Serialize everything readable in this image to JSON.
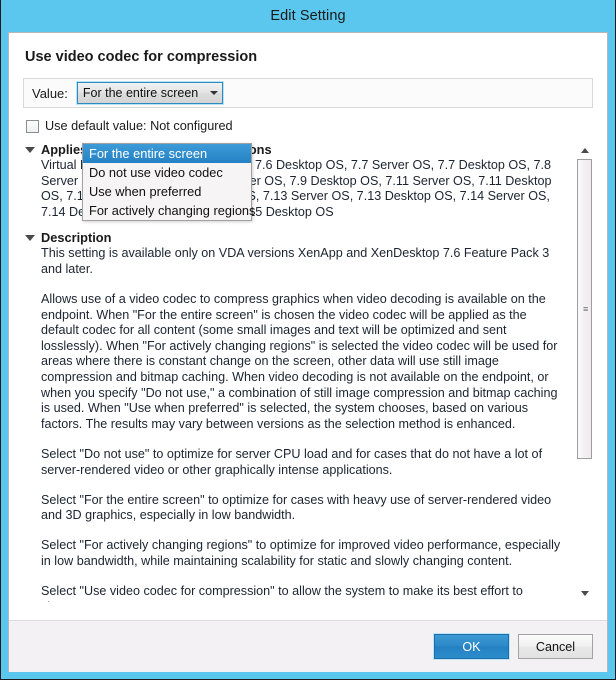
{
  "window": {
    "title": "Edit Setting",
    "accent_color": "#5bc7ee"
  },
  "setting": {
    "title": "Use video codec for compression",
    "value_label": "Value:",
    "current_value": "For the entire screen",
    "dropdown_open": true,
    "options": [
      "For the entire screen",
      "Do not use video codec",
      "Use when preferred",
      "For actively changing regions"
    ],
    "selected_index": 0,
    "use_default_label": "Use default value: Not configured",
    "use_default_checked": false
  },
  "applies_to": {
    "heading": "Applies to the following VDA versions",
    "body": "Virtual Delivery Agent: 7.6 Server OS, 7.6 Desktop OS, 7.7 Server OS, 7.7 Desktop OS, 7.8 Server OS, 7.8 Desktop OS, 7.9 Server OS, 7.9 Desktop OS, 7.11 Server OS, 7.11 Desktop OS, 7.12 Server OS, 7.12 Desktop OS, 7.13 Server OS, 7.13 Desktop OS, 7.14 Server OS, 7.14 Desktop OS, 7.15 Server OS, 7.15 Desktop OS"
  },
  "description": {
    "heading": "Description",
    "paragraphs": [
      "This setting is available only on VDA versions XenApp and XenDesktop 7.6 Feature Pack 3 and later.",
      "Allows use of a video codec to compress graphics when video decoding is available on the endpoint. When \"For the entire screen\" is chosen the video codec will be applied as the default codec for all content (some small images and text will be optimized and sent losslessly). When \"For actively changing regions\" is selected the video codec will be used for areas where there is constant change on the screen, other data will use still image compression and bitmap caching. When video decoding is not available on the endpoint, or when you specify \"Do not use,\" a combination of still image compression and bitmap caching is used. When \"Use when preferred\" is selected, the system chooses, based on various factors. The results may vary between versions as the selection method is enhanced.",
      "Select \"Do not use\" to optimize for server CPU load and for cases that do not have a lot of server-rendered video or other graphically intense applications.",
      "Select \"For the entire screen\" to optimize for cases with heavy use of server-rendered video and 3D graphics, especially in low bandwidth.",
      "Select \"For actively changing regions\" to optimize for improved video performance, especially in low bandwidth, while maintaining scalability for static and slowly changing content.",
      "Select \"Use video codec for compression\" to allow the system to make its best effort to choose"
    ]
  },
  "scrollbar": {
    "up_icon": "scroll-up-arrow",
    "down_icon": "scroll-down-arrow",
    "grip_icon": "scroll-thumb-grip"
  },
  "buttons": {
    "ok": "OK",
    "cancel": "Cancel"
  }
}
